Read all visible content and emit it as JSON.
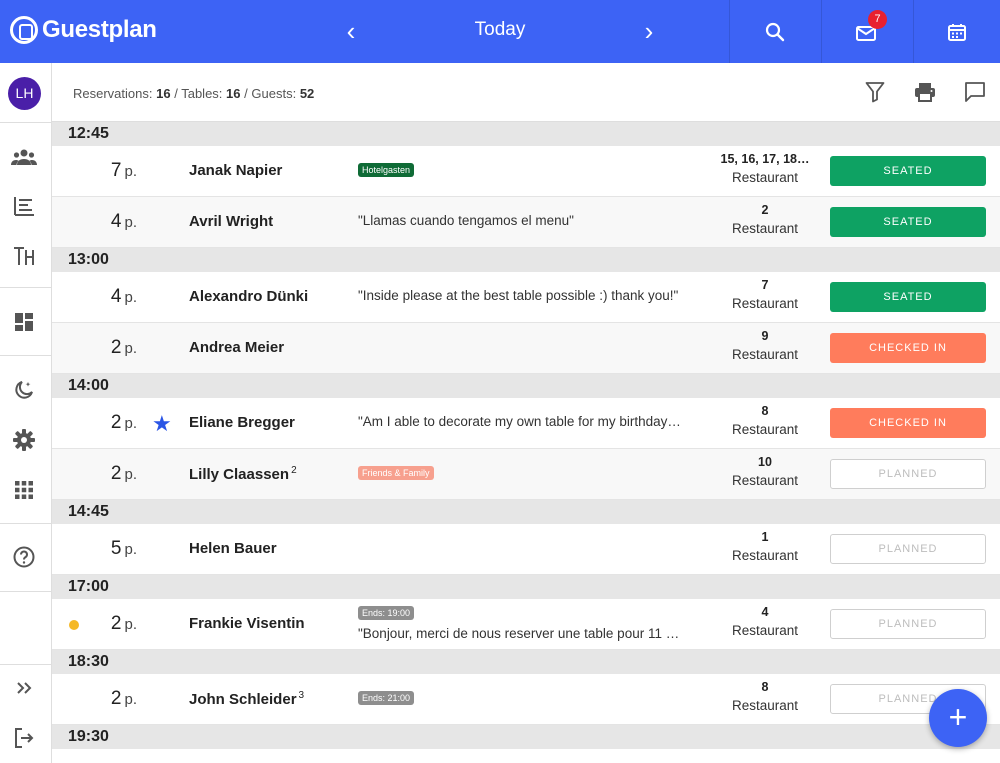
{
  "header": {
    "brand": "Guestplan",
    "date_label": "Today",
    "prev_symbol": "‹",
    "next_symbol": "›",
    "inbox_badge": "7"
  },
  "sidebar": {
    "avatar_initials": "LH"
  },
  "summary": {
    "reservations_label": "Reservations:",
    "reservations_count": "16",
    "tables_label": "Tables:",
    "tables_count": "16",
    "guests_label": "Guests:",
    "guests_count": "52",
    "separator": "/"
  },
  "colors": {
    "brand_blue": "#3d63f5",
    "seated_green": "#0ea263",
    "checked_in_orange": "#ff7c5c",
    "badge_red": "#e8202f",
    "star_blue": "#2a55e5",
    "dot_yellow": "#f5b825"
  },
  "groups": [
    {
      "time": "12:45",
      "rows": [
        {
          "party": "7",
          "unit": "p.",
          "name": "Janak Napier",
          "tag": "Hotelgasten",
          "tables": "15, 16, 17, 18…",
          "area": "Restaurant",
          "status": "SEATED"
        },
        {
          "party": "4",
          "unit": "p.",
          "name": "Avril Wright",
          "note": "\"Llamas cuando tengamos el menu\"",
          "tables": "2",
          "area": "Restaurant",
          "status": "SEATED"
        }
      ]
    },
    {
      "time": "13:00",
      "rows": [
        {
          "party": "4",
          "unit": "p.",
          "name": "Alexandro Dünki",
          "note": "\"Inside please at the best table possible :) thank you!\"",
          "tables": "7",
          "area": "Restaurant",
          "status": "SEATED"
        },
        {
          "party": "2",
          "unit": "p.",
          "name": "Andrea Meier",
          "tables": "9",
          "area": "Restaurant",
          "status": "CHECKED IN"
        }
      ]
    },
    {
      "time": "14:00",
      "rows": [
        {
          "party": "2",
          "unit": "p.",
          "name": "Eliane Bregger",
          "note": "\"Am I able to decorate my own table for my birthday…",
          "tables": "8",
          "area": "Restaurant",
          "status": "CHECKED IN"
        },
        {
          "party": "2",
          "unit": "p.",
          "name": "Lilly Claassen",
          "visits": "2",
          "tag": "Friends & Family",
          "tables": "10",
          "area": "Restaurant",
          "status": "PLANNED"
        }
      ]
    },
    {
      "time": "14:45",
      "rows": [
        {
          "party": "5",
          "unit": "p.",
          "name": "Helen Bauer",
          "tables": "1",
          "area": "Restaurant",
          "status": "PLANNED"
        }
      ]
    },
    {
      "time": "17:00",
      "rows": [
        {
          "party": "2",
          "unit": "p.",
          "name": "Frankie Visentin",
          "tag": "Ends: 19:00",
          "note": "\"Bonjour, merci de nous reserver une table pour 11 …",
          "tables": "4",
          "area": "Restaurant",
          "status": "PLANNED"
        }
      ]
    },
    {
      "time": "18:30",
      "rows": [
        {
          "party": "2",
          "unit": "p.",
          "name": "John Schleider",
          "visits": "3",
          "tag": "Ends: 21:00",
          "tables": "8",
          "area": "Restaurant",
          "status": "PLANNED"
        }
      ]
    },
    {
      "time": "19:30",
      "rows": []
    }
  ],
  "fab_label": "+"
}
